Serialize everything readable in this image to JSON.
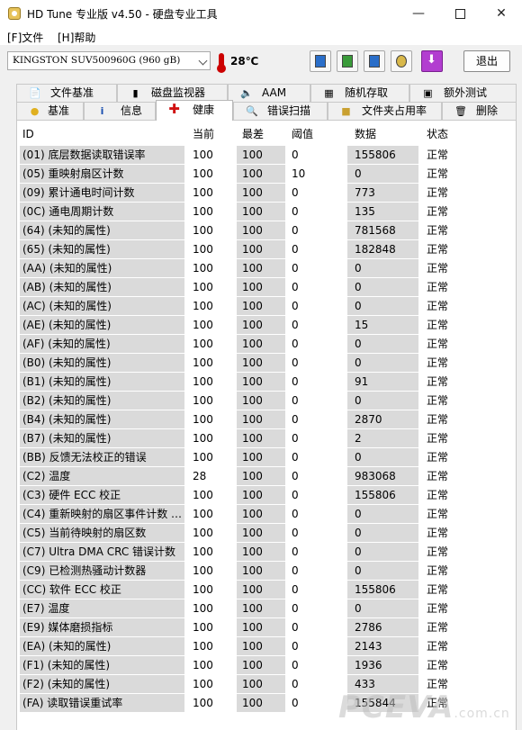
{
  "window": {
    "title": "HD Tune 专业版 v4.50 - 硬盘专业工具",
    "minimize_glyph": "—",
    "close_glyph": "✕"
  },
  "menu": {
    "file": "[F]文件",
    "help": "[H]帮助"
  },
  "toolbar": {
    "drive": "KINGSTON SUV500960G (960 gB)",
    "temperature": "28℃",
    "exit_label": "退出"
  },
  "tabs_row1": [
    {
      "label": "文件基准",
      "icon": "file-benchmark-icon"
    },
    {
      "label": "磁盘监视器",
      "icon": "disk-monitor-icon"
    },
    {
      "label": "AAM",
      "icon": "speaker-icon"
    },
    {
      "label": "随机存取",
      "icon": "random-access-icon"
    },
    {
      "label": "额外测试",
      "icon": "extra-tests-icon"
    }
  ],
  "tabs_row2": [
    {
      "label": "基准",
      "icon": "benchmark-icon"
    },
    {
      "label": "信息",
      "icon": "info-icon"
    },
    {
      "label": "健康",
      "icon": "health-cross-icon",
      "active": true
    },
    {
      "label": "错误扫描",
      "icon": "magnifier-icon"
    },
    {
      "label": "文件夹占用率",
      "icon": "folder-icon"
    },
    {
      "label": "删除",
      "icon": "trash-icon"
    }
  ],
  "table": {
    "columns": {
      "id": "ID",
      "current": "当前",
      "worst": "最差",
      "threshold": "阈值",
      "data": "数据",
      "status": "状态"
    },
    "rows": [
      {
        "id": "(01) 底层数据读取错误率",
        "current": "100",
        "worst": "100",
        "threshold": "0",
        "data": "155806",
        "status": "正常"
      },
      {
        "id": "(05) 重映射扇区计数",
        "current": "100",
        "worst": "100",
        "threshold": "10",
        "data": "0",
        "status": "正常"
      },
      {
        "id": "(09) 累计通电时间计数",
        "current": "100",
        "worst": "100",
        "threshold": "0",
        "data": "773",
        "status": "正常"
      },
      {
        "id": "(0C) 通电周期计数",
        "current": "100",
        "worst": "100",
        "threshold": "0",
        "data": "135",
        "status": "正常"
      },
      {
        "id": "(64) (未知的属性)",
        "current": "100",
        "worst": "100",
        "threshold": "0",
        "data": "781568",
        "status": "正常"
      },
      {
        "id": "(65) (未知的属性)",
        "current": "100",
        "worst": "100",
        "threshold": "0",
        "data": "182848",
        "status": "正常"
      },
      {
        "id": "(AA) (未知的属性)",
        "current": "100",
        "worst": "100",
        "threshold": "0",
        "data": "0",
        "status": "正常"
      },
      {
        "id": "(AB) (未知的属性)",
        "current": "100",
        "worst": "100",
        "threshold": "0",
        "data": "0",
        "status": "正常"
      },
      {
        "id": "(AC) (未知的属性)",
        "current": "100",
        "worst": "100",
        "threshold": "0",
        "data": "0",
        "status": "正常"
      },
      {
        "id": "(AE) (未知的属性)",
        "current": "100",
        "worst": "100",
        "threshold": "0",
        "data": "15",
        "status": "正常"
      },
      {
        "id": "(AF) (未知的属性)",
        "current": "100",
        "worst": "100",
        "threshold": "0",
        "data": "0",
        "status": "正常"
      },
      {
        "id": "(B0) (未知的属性)",
        "current": "100",
        "worst": "100",
        "threshold": "0",
        "data": "0",
        "status": "正常"
      },
      {
        "id": "(B1) (未知的属性)",
        "current": "100",
        "worst": "100",
        "threshold": "0",
        "data": "91",
        "status": "正常"
      },
      {
        "id": "(B2) (未知的属性)",
        "current": "100",
        "worst": "100",
        "threshold": "0",
        "data": "0",
        "status": "正常"
      },
      {
        "id": "(B4) (未知的属性)",
        "current": "100",
        "worst": "100",
        "threshold": "0",
        "data": "2870",
        "status": "正常"
      },
      {
        "id": "(B7) (未知的属性)",
        "current": "100",
        "worst": "100",
        "threshold": "0",
        "data": "2",
        "status": "正常"
      },
      {
        "id": "(BB) 反馈无法校正的错误",
        "current": "100",
        "worst": "100",
        "threshold": "0",
        "data": "0",
        "status": "正常"
      },
      {
        "id": "(C2) 温度",
        "current": "28",
        "worst": "100",
        "threshold": "0",
        "data": "983068",
        "status": "正常"
      },
      {
        "id": "(C3) 硬件 ECC 校正",
        "current": "100",
        "worst": "100",
        "threshold": "0",
        "data": "155806",
        "status": "正常"
      },
      {
        "id": "(C4) 重新映射的扇区事件计数 …",
        "current": "100",
        "worst": "100",
        "threshold": "0",
        "data": "0",
        "status": "正常"
      },
      {
        "id": "(C5) 当前待映射的扇区数",
        "current": "100",
        "worst": "100",
        "threshold": "0",
        "data": "0",
        "status": "正常"
      },
      {
        "id": "(C7) Ultra DMA CRC 错误计数",
        "current": "100",
        "worst": "100",
        "threshold": "0",
        "data": "0",
        "status": "正常"
      },
      {
        "id": "(C9) 已检测热骚动计数器",
        "current": "100",
        "worst": "100",
        "threshold": "0",
        "data": "0",
        "status": "正常"
      },
      {
        "id": "(CC) 软件 ECC 校正",
        "current": "100",
        "worst": "100",
        "threshold": "0",
        "data": "155806",
        "status": "正常"
      },
      {
        "id": "(E7) 温度",
        "current": "100",
        "worst": "100",
        "threshold": "0",
        "data": "0",
        "status": "正常"
      },
      {
        "id": "(E9) 媒体磨损指标",
        "current": "100",
        "worst": "100",
        "threshold": "0",
        "data": "2786",
        "status": "正常"
      },
      {
        "id": "(EA) (未知的属性)",
        "current": "100",
        "worst": "100",
        "threshold": "0",
        "data": "2143",
        "status": "正常"
      },
      {
        "id": "(F1) (未知的属性)",
        "current": "100",
        "worst": "100",
        "threshold": "0",
        "data": "1936",
        "status": "正常"
      },
      {
        "id": "(F2) (未知的属性)",
        "current": "100",
        "worst": "100",
        "threshold": "0",
        "data": "433",
        "status": "正常"
      },
      {
        "id": "(FA) 读取错误重试率",
        "current": "100",
        "worst": "100",
        "threshold": "0",
        "data": "155844",
        "status": "正常"
      }
    ]
  },
  "watermark": {
    "brand": "PCEVA",
    "domain": ".com.cn"
  }
}
